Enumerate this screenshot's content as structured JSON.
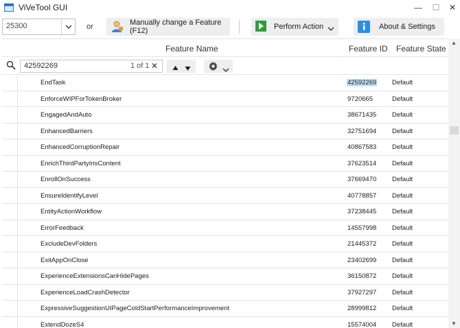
{
  "window": {
    "title": "ViVeTool GUI",
    "minimize": "—",
    "maximize": "☐",
    "close": "✕"
  },
  "toolbar": {
    "build_value": "25300",
    "or_label": "or",
    "manual_label": "Manually change a Feature (F12)",
    "perform_label": "Perform Action",
    "about_label": "About & Settings"
  },
  "grid": {
    "columns": [
      "Feature Name",
      "Feature ID",
      "Feature State"
    ],
    "search": {
      "value": "42592269",
      "match_count": "1 of 1",
      "clear": "✕"
    },
    "rows": [
      {
        "name": "EndTask",
        "id": "42592269",
        "state": "Default"
      },
      {
        "name": "EnforceWIPForTokenBroker",
        "id": "9720665",
        "state": "Default"
      },
      {
        "name": "EngagedAndAuto",
        "id": "38671435",
        "state": "Default"
      },
      {
        "name": "EnhancedBarriers",
        "id": "32751694",
        "state": "Default"
      },
      {
        "name": "EnhancedCorruptionRepair",
        "id": "40867583",
        "state": "Default"
      },
      {
        "name": "EnrichThirdPartyIrisContent",
        "id": "37623514",
        "state": "Default"
      },
      {
        "name": "EnrollOnSuccess",
        "id": "37669470",
        "state": "Default"
      },
      {
        "name": "EnsureIdentifyLevel",
        "id": "40778857",
        "state": "Default"
      },
      {
        "name": "EntityActionWorkflow",
        "id": "37238445",
        "state": "Default"
      },
      {
        "name": "ErrorFeedback",
        "id": "14557998",
        "state": "Default"
      },
      {
        "name": "ExcludeDevFolders",
        "id": "21445372",
        "state": "Default"
      },
      {
        "name": "ExitAppOnClose",
        "id": "23402699",
        "state": "Default"
      },
      {
        "name": "ExperienceExtensionsCanHidePages",
        "id": "36150872",
        "state": "Default"
      },
      {
        "name": "ExperienceLoadCrashDetector",
        "id": "37927297",
        "state": "Default"
      },
      {
        "name": "ExpressiveSuggestionUIPageColdStartPerformanceImprovement",
        "id": "28999812",
        "state": "Default"
      },
      {
        "name": "ExtendDozeS4",
        "id": "15574004",
        "state": "Default"
      }
    ]
  },
  "colors": {
    "highlight": "#bfe3f5",
    "button_bg": "#eeeeee",
    "accent_blue": "#2b74c8",
    "play_green": "#2e9e3a"
  },
  "icons": [
    "app-icon",
    "user-icon",
    "play-icon",
    "info-icon",
    "search-icon",
    "gear-icon",
    "chevron-down-icon"
  ]
}
